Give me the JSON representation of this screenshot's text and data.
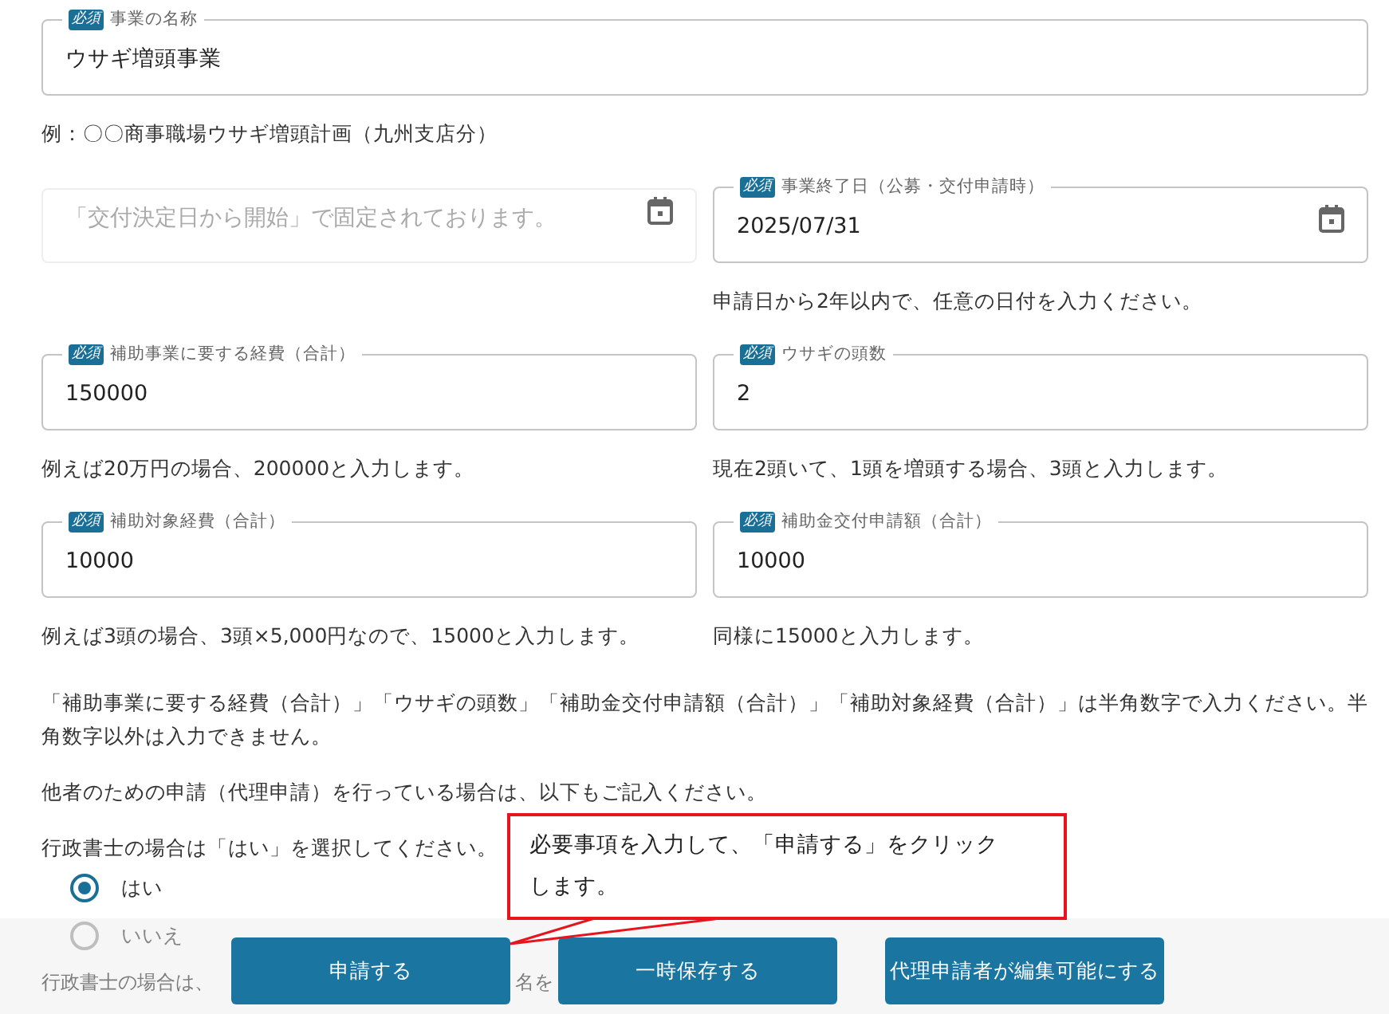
{
  "rows": [
    {
      "fields": [
        {
          "kind": "text",
          "badge": "必須",
          "label": "事業の名称",
          "value": "ウサギ増頭事業",
          "hint": "例：〇〇商事職場ウサギ増頭計画（九州支店分）"
        }
      ]
    },
    {
      "fields": [
        {
          "kind": "fixed",
          "placeholder": "「交付決定日から開始」で固定されております。"
        },
        {
          "kind": "date",
          "badge": "必須",
          "label": "事業終了日（公募・交付申請時）",
          "value": "2025/07/31",
          "hint": "申請日から2年以内で、任意の日付を入力ください。"
        }
      ]
    },
    {
      "fields": [
        {
          "kind": "text",
          "badge": "必須",
          "label": "補助事業に要する経費（合計）",
          "value": "150000",
          "hint": "例えば20万円の場合、200000と入力します。"
        },
        {
          "kind": "text",
          "badge": "必須",
          "label": "ウサギの頭数",
          "value": "2",
          "hint": "現在2頭いて、1頭を増頭する場合、3頭と入力します。"
        }
      ]
    },
    {
      "fields": [
        {
          "kind": "text",
          "badge": "必須",
          "label": "補助対象経費（合計）",
          "value": "10000",
          "hint": "例えば3頭の場合、3頭×5,000円なので、15000と入力します。"
        },
        {
          "kind": "text",
          "badge": "必須",
          "label": "補助金交付申請額（合計）",
          "value": "10000",
          "hint": "同様に15000と入力します。"
        }
      ]
    }
  ],
  "notes": [
    "「補助事業に要する経費（合計）」「ウサギの頭数」「補助金交付申請額（合計）」「補助対象経費（合計）」は半角数字で入力ください。半角数字以外は入力できません。",
    "他者のための申請（代理申請）を行っている場合は、以下もご記入ください。"
  ],
  "radio_group": {
    "prompt": "行政書士の場合は「はい」を選択してください。",
    "options": [
      {
        "label": "はい",
        "selected": true
      },
      {
        "label": "いいえ",
        "selected": false
      }
    ]
  },
  "partial_note": [
    "行政書士の場合は、",
    "名を"
  ],
  "callout": {
    "text": "必要事項を入力して、「申請する」をクリックします。"
  },
  "actions": [
    "申請する",
    "一時保存する",
    "代理申請者が編集可能にする"
  ]
}
